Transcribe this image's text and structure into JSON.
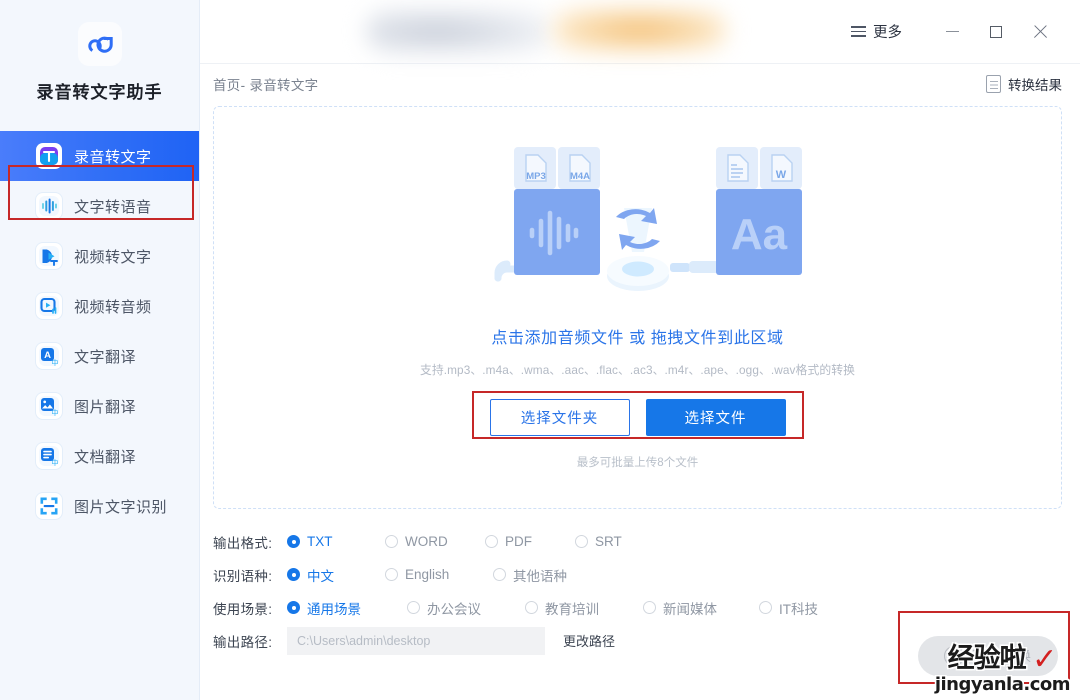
{
  "app": {
    "brand_name": "录音转文字助手",
    "logo_icon": "app-logo-icon",
    "accent_color": "#1677e8",
    "sidebar_bg": "#f3f7fd",
    "annotation_color": "#c62828"
  },
  "sidebar": {
    "items": [
      {
        "label": "录音转文字",
        "icon": "audio-to-text-icon",
        "active": true
      },
      {
        "label": "文字转语音",
        "icon": "text-to-speech-icon",
        "active": false
      },
      {
        "label": "视频转文字",
        "icon": "video-to-text-icon",
        "active": false
      },
      {
        "label": "视频转音频",
        "icon": "video-to-audio-icon",
        "active": false
      },
      {
        "label": "文字翻译",
        "icon": "text-translate-icon",
        "active": false
      },
      {
        "label": "图片翻译",
        "icon": "image-translate-icon",
        "active": false
      },
      {
        "label": "文档翻译",
        "icon": "doc-translate-icon",
        "active": false
      },
      {
        "label": "图片文字识别",
        "icon": "ocr-icon",
        "active": false
      }
    ]
  },
  "titlebar": {
    "more_label": "更多",
    "more_icon": "hamburger-icon",
    "minimize_icon": "minimize-icon",
    "maximize_icon": "maximize-icon",
    "close_icon": "close-icon"
  },
  "subbar": {
    "breadcrumb": "首页- 录音转文字",
    "result_label": "转换结果",
    "result_icon": "document-icon"
  },
  "dropzone": {
    "title": "点击添加音频文件 或 拖拽文件到此区域",
    "formats": "支持.mp3、.m4a、.wma、.aac、.flac、.ac3、.m4r、.ape、.ogg、.wav格式的转换",
    "select_folder_label": "选择文件夹",
    "select_file_label": "选择文件",
    "note": "最多可批量上传8个文件",
    "illustration": {
      "source_tags": [
        "MP3",
        "M4A"
      ],
      "source_glyph": "waveform-icon",
      "convert_glyph": "convert-arrows-icon",
      "target_tags": [
        "document-icon",
        "W"
      ],
      "target_glyph": "Aa"
    }
  },
  "options": {
    "format": {
      "label": "输出格式:",
      "choices": [
        {
          "label": "TXT",
          "selected": true
        },
        {
          "label": "WORD",
          "selected": false
        },
        {
          "label": "PDF",
          "selected": false
        },
        {
          "label": "SRT",
          "selected": false
        }
      ]
    },
    "language": {
      "label": "识别语种:",
      "choices": [
        {
          "label": "中文",
          "selected": true
        },
        {
          "label": "English",
          "selected": false
        },
        {
          "label": "其他语种",
          "selected": false
        }
      ]
    },
    "scene": {
      "label": "使用场景:",
      "choices": [
        {
          "label": "通用场景",
          "selected": true
        },
        {
          "label": "办公会议",
          "selected": false
        },
        {
          "label": "教育培训",
          "selected": false
        },
        {
          "label": "新闻媒体",
          "selected": false
        },
        {
          "label": "IT科技",
          "selected": false
        }
      ]
    },
    "path": {
      "label": "输出路径:",
      "value": "",
      "placeholder": "C:\\Users\\admin\\desktop",
      "change_label": "更改路径"
    }
  },
  "start_button": {
    "label": "开始转换",
    "icon": "convert-circle-icon",
    "enabled": false
  },
  "watermark": {
    "text_cn": "经验啦",
    "check": "✓",
    "url": "jingyanla.com"
  }
}
